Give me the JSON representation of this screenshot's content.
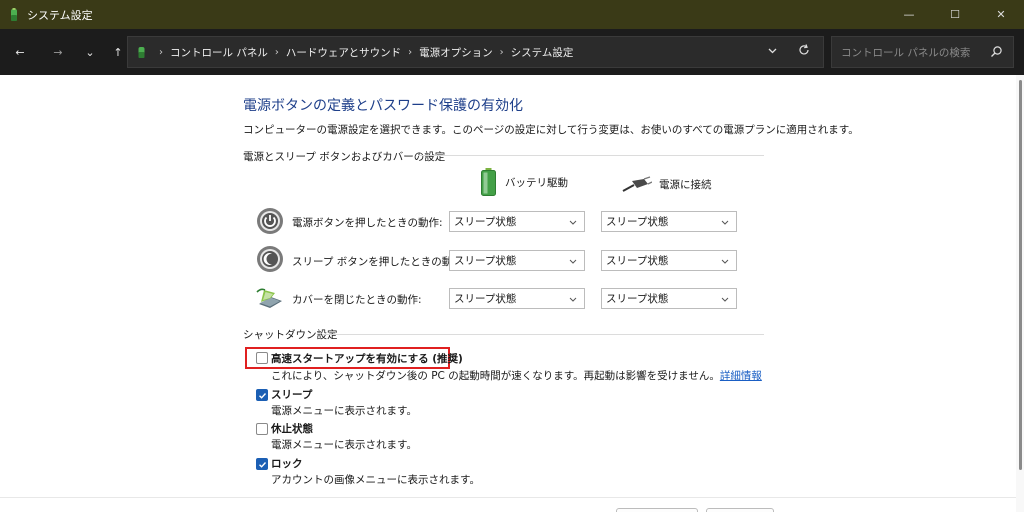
{
  "window": {
    "title": "システム設定",
    "minimize": "—",
    "maximize": "☐",
    "close": "✕"
  },
  "nav": {
    "back": "←",
    "forward": "→",
    "recent": "⌄",
    "up": "↑",
    "breadcrumb": [
      "コントロール パネル",
      "ハードウェアとサウンド",
      "電源オプション",
      "システム設定"
    ],
    "search_placeholder": "コントロール パネルの検索"
  },
  "page": {
    "title": "電源ボタンの定義とパスワード保護の有効化",
    "description": "コンピューターの電源設定を選択できます。このページの設定に対して行う変更は、お使いのすべての電源プランに適用されます。"
  },
  "power_group": {
    "label": "電源とスリープ ボタンおよびカバーの設定",
    "col_battery": "バッテリ駆動",
    "col_plugged": "電源に接続",
    "rows": [
      {
        "label": "電源ボタンを押したときの動作:",
        "battery": "スリープ状態",
        "plugged": "スリープ状態",
        "icon": "power-icon"
      },
      {
        "label": "スリープ ボタンを押したときの動作:",
        "battery": "スリープ状態",
        "plugged": "スリープ状態",
        "icon": "sleep-icon"
      },
      {
        "label": "カバーを閉じたときの動作:",
        "battery": "スリープ状態",
        "plugged": "スリープ状態",
        "icon": "laptop-lid-icon"
      }
    ]
  },
  "shutdown_group": {
    "label": "シャットダウン設定",
    "items": [
      {
        "title": "高速スタートアップを有効にする (推奨)",
        "desc": "これにより、シャットダウン後の PC の起動時間が速くなります。再起動は影響を受けません。",
        "link": "詳細情報",
        "checked": false
      },
      {
        "title": "スリープ",
        "desc": "電源メニューに表示されます。",
        "checked": true
      },
      {
        "title": "休止状態",
        "desc": "電源メニューに表示されます。",
        "checked": false
      },
      {
        "title": "ロック",
        "desc": "アカウントの画像メニューに表示されます。",
        "checked": true
      }
    ]
  },
  "colors": {
    "titlebar": "#3a3a17",
    "navbar": "#1c1c1c",
    "accent": "#1b5fb4",
    "heading": "#1e3f8a",
    "highlight": "#e02020"
  }
}
